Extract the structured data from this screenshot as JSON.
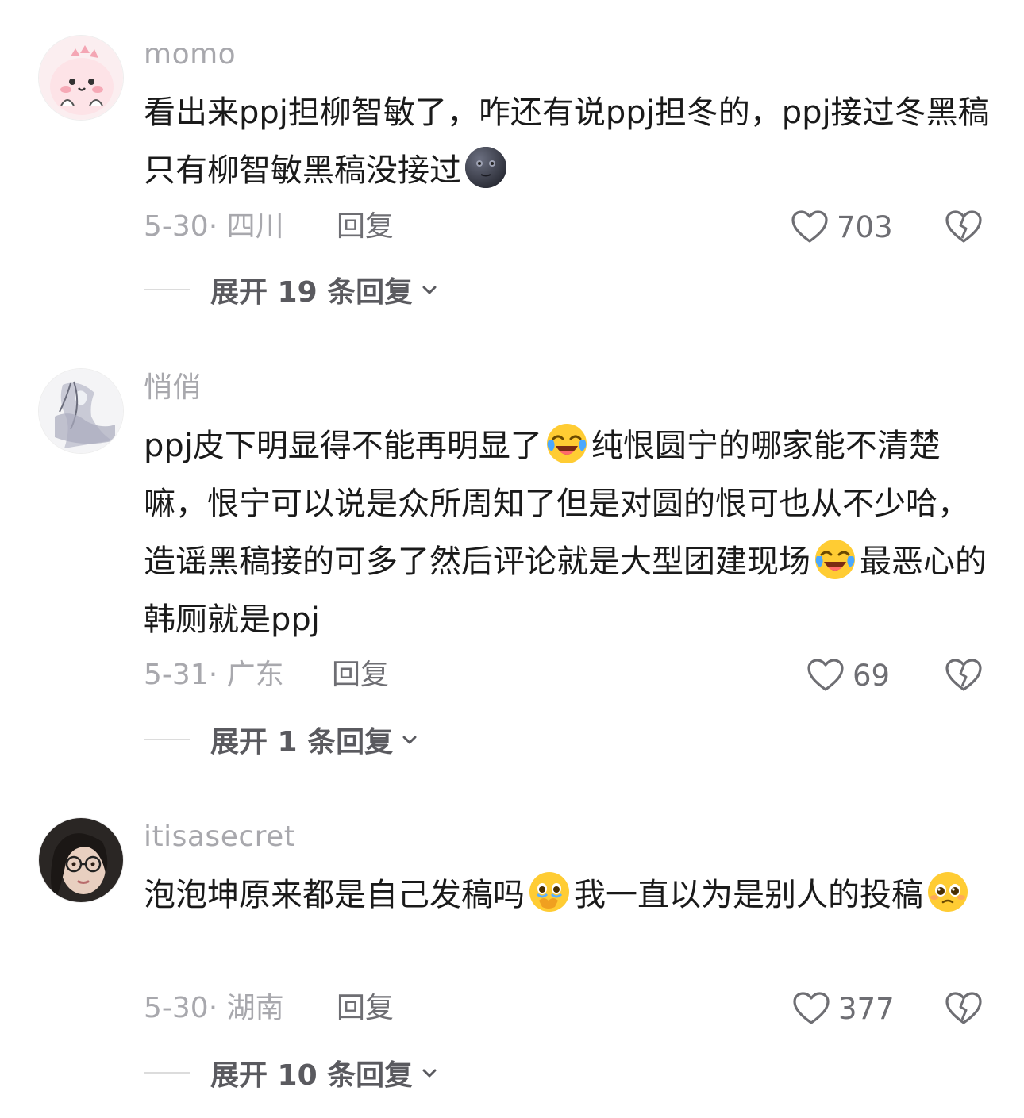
{
  "comments": [
    {
      "username": "momo",
      "avatar_icon": "pink-dino-avatar",
      "text": "看出来ppj担柳智敏了，咋还有说ppj担冬的，ppj接过冬黑稿只有柳智敏黑稿没接过",
      "trailing_emoji": "dark-moon-face-emoji",
      "date": "5-30",
      "location": "四川",
      "reply_label": "回复",
      "likes": "703",
      "expand_label": "展开 19 条回复"
    },
    {
      "username": "悄俏",
      "avatar_icon": "ink-painting-figure-avatar",
      "text_parts": [
        "ppj皮下明显得不能再明显了",
        "纯恨圆宁的哪家能不清楚嘛，恨宁可以说是众所周知了但是对圆的恨可也从不少哈，造谣黑稿接的可多了然后评论就是大型团建现场",
        "最恶心的韩厕就是ppj"
      ],
      "emoji": "laughing-crying-emoji",
      "date": "5-31",
      "location": "广东",
      "reply_label": "回复",
      "likes": "69",
      "expand_label": "展开 1 条回复"
    },
    {
      "username": "itisasecret",
      "avatar_icon": "girl-with-glasses-avatar",
      "text_parts": [
        "泡泡坤原来都是自己发稿吗",
        "我一直以为是别人的投稿"
      ],
      "emoji_1": "holding-back-tears-emoji",
      "emoji_2": "pleading-face-emoji",
      "date": "5-30",
      "location": "湖南",
      "reply_label": "回复",
      "likes": "377",
      "expand_label": "展开 10 条回复"
    }
  ],
  "icons": {
    "like": "heart-outline-icon",
    "dislike": "broken-heart-icon",
    "expand": "chevron-down-icon"
  },
  "colors": {
    "username": "#a8a8ad",
    "body_text": "#1a1a1a",
    "action": "#6e6e73"
  }
}
